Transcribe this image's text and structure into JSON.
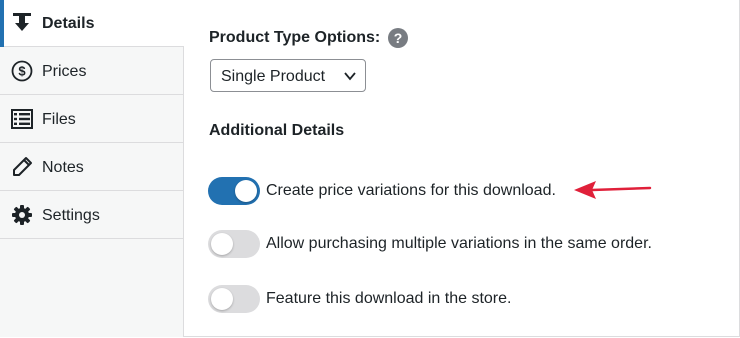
{
  "sidebar": {
    "items": [
      {
        "label": "Details",
        "icon": "download-icon",
        "active": true
      },
      {
        "label": "Prices",
        "icon": "dollar-icon",
        "active": false
      },
      {
        "label": "Files",
        "icon": "list-icon",
        "active": false
      },
      {
        "label": "Notes",
        "icon": "pencil-icon",
        "active": false
      },
      {
        "label": "Settings",
        "icon": "gear-icon",
        "active": false
      }
    ]
  },
  "main": {
    "product_type_label": "Product Type Options:",
    "help_icon_glyph": "?",
    "product_type_select": {
      "value": "Single Product"
    },
    "additional_details_title": "Additional Details",
    "toggles": [
      {
        "label": "Create price variations for this download.",
        "on": true
      },
      {
        "label": "Allow purchasing multiple variations in the same order.",
        "on": false
      },
      {
        "label": "Feature this download in the store.",
        "on": false
      }
    ]
  },
  "colors": {
    "accent": "#2271b1",
    "annotation_arrow": "#e0203a",
    "toggle_off": "#dcdcde",
    "sidebar_bg": "#f6f7f7"
  }
}
